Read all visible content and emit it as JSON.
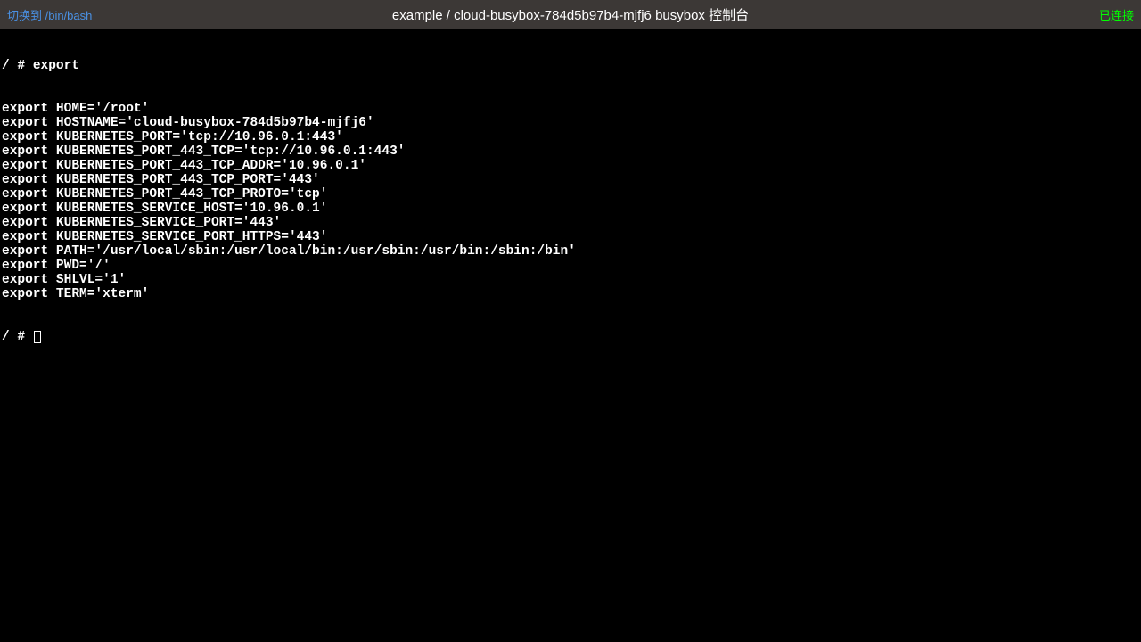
{
  "header": {
    "switch_link": "切换到 /bin/bash",
    "title": "example / cloud-busybox-784d5b97b4-mjfj6 busybox 控制台",
    "status": "已连接"
  },
  "terminal": {
    "prompt": "/ # ",
    "command": "export",
    "output": [
      "export HOME='/root'",
      "export HOSTNAME='cloud-busybox-784d5b97b4-mjfj6'",
      "export KUBERNETES_PORT='tcp://10.96.0.1:443'",
      "export KUBERNETES_PORT_443_TCP='tcp://10.96.0.1:443'",
      "export KUBERNETES_PORT_443_TCP_ADDR='10.96.0.1'",
      "export KUBERNETES_PORT_443_TCP_PORT='443'",
      "export KUBERNETES_PORT_443_TCP_PROTO='tcp'",
      "export KUBERNETES_SERVICE_HOST='10.96.0.1'",
      "export KUBERNETES_SERVICE_PORT='443'",
      "export KUBERNETES_SERVICE_PORT_HTTPS='443'",
      "export PATH='/usr/local/sbin:/usr/local/bin:/usr/sbin:/usr/bin:/sbin:/bin'",
      "export PWD='/'",
      "export SHLVL='1'",
      "export TERM='xterm'"
    ],
    "next_prompt": "/ # "
  }
}
